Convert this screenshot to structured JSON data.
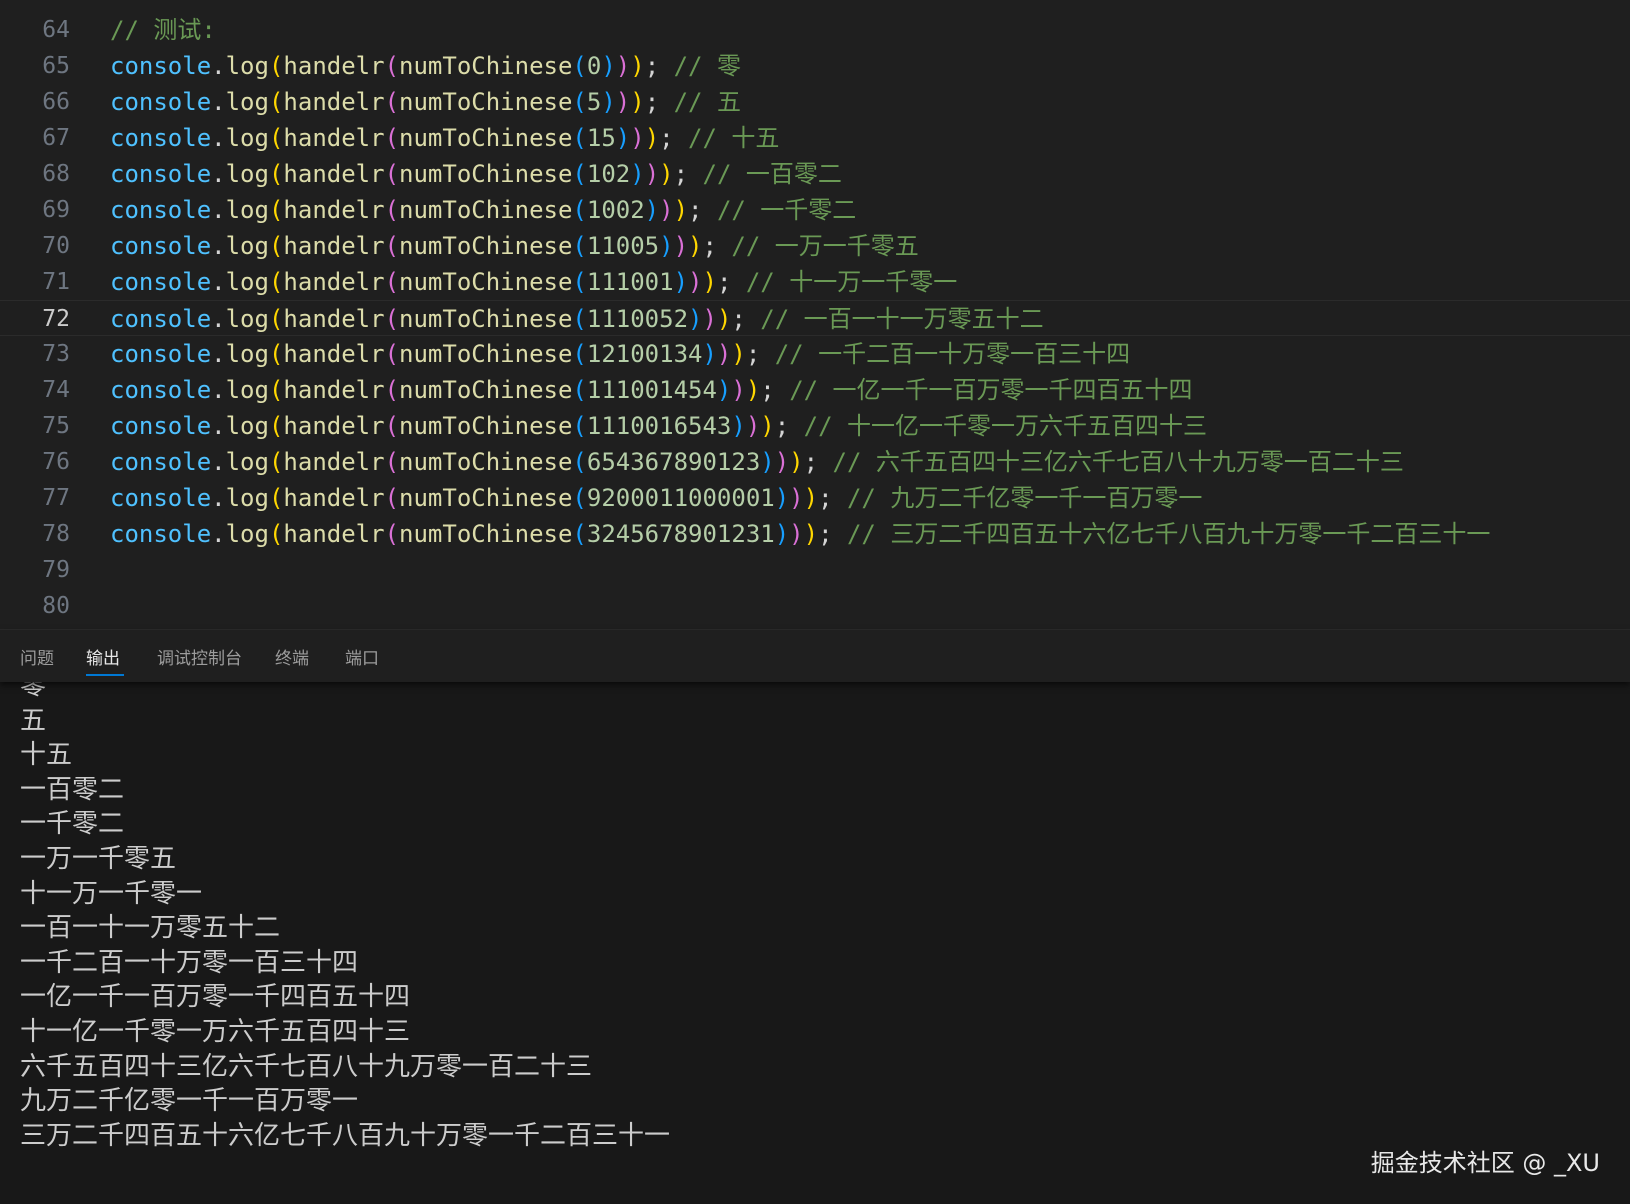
{
  "editor": {
    "active_line": "72",
    "lines": [
      {
        "ln": "64",
        "comment": "// 测试:"
      },
      {
        "ln": "65",
        "arg": "0",
        "comment": "// 零"
      },
      {
        "ln": "66",
        "arg": "5",
        "comment": "// 五"
      },
      {
        "ln": "67",
        "arg": "15",
        "comment": "// 十五"
      },
      {
        "ln": "68",
        "arg": "102",
        "comment": "// 一百零二"
      },
      {
        "ln": "69",
        "arg": "1002",
        "comment": "// 一千零二"
      },
      {
        "ln": "70",
        "arg": "11005",
        "comment": "// 一万一千零五"
      },
      {
        "ln": "71",
        "arg": "111001",
        "comment": "// 十一万一千零一"
      },
      {
        "ln": "72",
        "arg": "1110052",
        "comment": "// 一百一十一万零五十二"
      },
      {
        "ln": "73",
        "arg": "12100134",
        "comment": "// 一千二百一十万零一百三十四"
      },
      {
        "ln": "74",
        "arg": "111001454",
        "comment": "// 一亿一千一百万零一千四百五十四"
      },
      {
        "ln": "75",
        "arg": "1110016543",
        "comment": "// 十一亿一千零一万六千五百四十三"
      },
      {
        "ln": "76",
        "arg": "654367890123",
        "comment": "// 六千五百四十三亿六千七百八十九万零一百二十三"
      },
      {
        "ln": "77",
        "arg": "9200011000001",
        "comment": "// 九万二千亿零一千一百万零一"
      },
      {
        "ln": "78",
        "arg": "3245678901231",
        "comment": "// 三万二千四百五十六亿七千八百九十万零一千二百三十一"
      },
      {
        "ln": "79"
      },
      {
        "ln": "80"
      }
    ],
    "tokens": {
      "console": "console",
      "dot": ".",
      "log": "log",
      "handler": "handelr",
      "numfn": "numToChinese",
      "open": "(",
      "close": ")",
      "semi": ";"
    }
  },
  "panel": {
    "tabs": [
      {
        "label": "问题",
        "active": false
      },
      {
        "label": "输出",
        "active": true
      },
      {
        "label": "调试控制台",
        "active": false
      },
      {
        "label": "终端",
        "active": false
      },
      {
        "label": "端口",
        "active": false
      }
    ],
    "output": [
      "零",
      "五",
      "十五",
      "一百零二",
      "一千零二",
      "一万一千零五",
      "十一万一千零一",
      "一百一十一万零五十二",
      "一千二百一十万零一百三十四",
      "一亿一千一百万零一千四百五十四",
      "十一亿一千零一万六千五百四十三",
      "六千五百四十三亿六千七百八十九万零一百二十三",
      "九万二千亿零一千一百万零一",
      "三万二千四百五十六亿七千八百九十万零一千二百三十一"
    ]
  },
  "watermark": "掘金技术社区 @ _XU",
  "colors": {
    "editor_bg": "#1f1f1f",
    "panel_bg": "#181818",
    "comment": "#6a9955",
    "object": "#4fc1ff",
    "function": "#dcdcaa",
    "number": "#b5cea8",
    "bracket_1": "#ffd700",
    "bracket_2": "#da70d6",
    "bracket_3": "#179fff",
    "tab_accent": "#0078d4"
  }
}
